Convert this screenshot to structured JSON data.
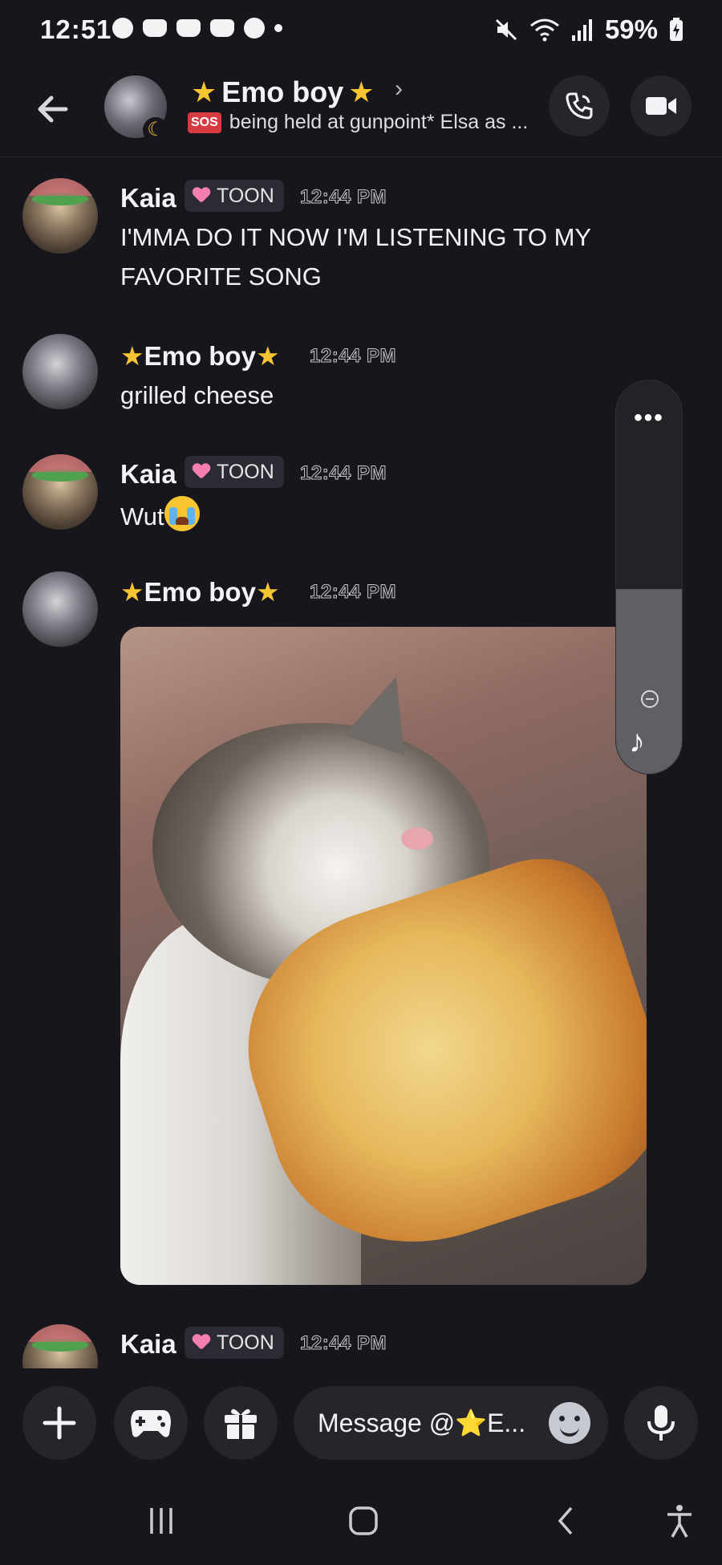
{
  "status_bar": {
    "time": "12:51",
    "battery": "59%"
  },
  "header": {
    "channel_name_text": "Emo boy",
    "status_badge": "SOS",
    "status_text": "being held at gunpoint* Elsa as ..."
  },
  "messages": [
    {
      "author": "Kaia",
      "tag": "TOON",
      "time": "12:44 PM",
      "text": "I'MMA DO IT NOW I'M LISTENING TO MY FAVORITE SONG"
    },
    {
      "author_text": "Emo boy",
      "time": "12:44 PM",
      "text": "grilled cheese"
    },
    {
      "author": "Kaia",
      "tag": "TOON",
      "time": "12:44 PM",
      "text": "Wut"
    },
    {
      "author_text": "Emo boy",
      "time": "12:44 PM"
    },
    {
      "author": "Kaia",
      "tag": "TOON",
      "time": "12:44 PM"
    }
  ],
  "volume_panel": {
    "more": "•••",
    "level_fraction": 0.47
  },
  "composer": {
    "placeholder": "Message @⭐E..."
  },
  "colors": {
    "background": "#17161c",
    "button_bg": "#26252c",
    "star": "#f7c531",
    "sos": "#d83a42",
    "toon_heart": "#f47fae"
  }
}
